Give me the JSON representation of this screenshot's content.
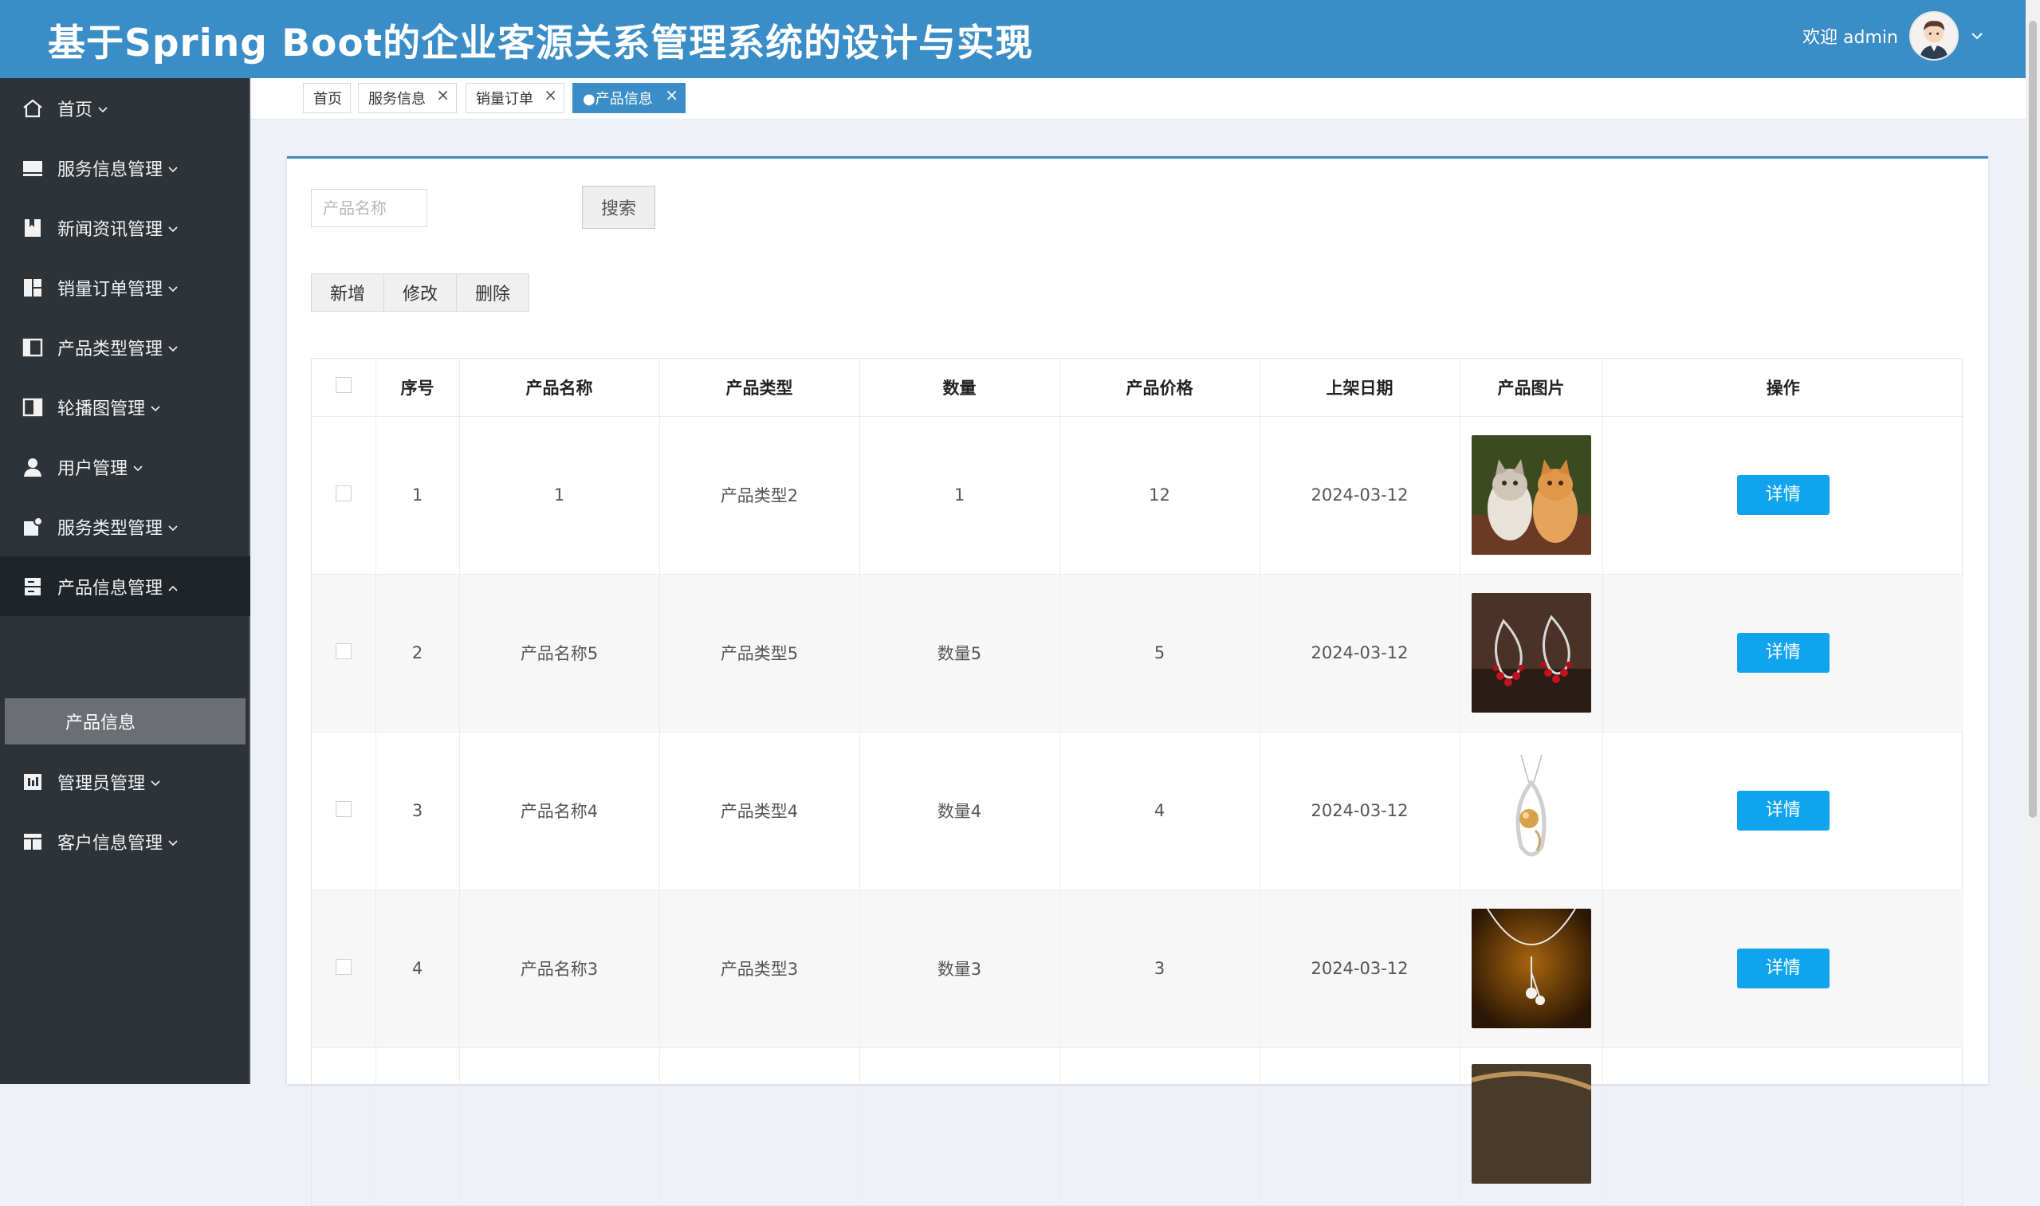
{
  "header": {
    "title": "基于Spring Boot的企业客源关系管理系统的设计与实现",
    "welcome": "欢迎 admin",
    "brand_color": "#3a8dc7"
  },
  "sidebar": {
    "items": [
      {
        "label": "首页",
        "icon": "home-icon"
      },
      {
        "label": "服务信息管理",
        "icon": "monitor-icon"
      },
      {
        "label": "新闻资讯管理",
        "icon": "bookmark-icon"
      },
      {
        "label": "销量订单管理",
        "icon": "dashboard-icon"
      },
      {
        "label": "产品类型管理",
        "icon": "columns-icon"
      },
      {
        "label": "轮播图管理",
        "icon": "slides-icon"
      },
      {
        "label": "用户管理",
        "icon": "user-icon"
      },
      {
        "label": "服务类型管理",
        "icon": "tag-icon"
      },
      {
        "label": "产品信息管理",
        "icon": "server-icon"
      },
      {
        "label": "管理员管理",
        "icon": "chart-icon"
      },
      {
        "label": "客户信息管理",
        "icon": "table-icon"
      }
    ],
    "sub_item": "产品信息"
  },
  "tabs": [
    {
      "label": "首页"
    },
    {
      "label": "服务信息"
    },
    {
      "label": "销量订单"
    },
    {
      "label": "●产品信息"
    }
  ],
  "search": {
    "placeholder": "产品名称",
    "button": "搜索"
  },
  "toolbar": {
    "add": "新增",
    "edit": "修改",
    "delete": "删除"
  },
  "table": {
    "headers": [
      "序号",
      "产品名称",
      "产品类型",
      "数量",
      "产品价格",
      "上架日期",
      "产品图片",
      "操作"
    ],
    "rows": [
      {
        "no": "1",
        "name": "1",
        "type": "产品类型2",
        "qty": "1",
        "price": "12",
        "date": "2024-03-12",
        "image": "kittens-photo",
        "action": "详情"
      },
      {
        "no": "2",
        "name": "产品名称5",
        "type": "产品类型5",
        "qty": "数量5",
        "price": "5",
        "date": "2024-03-12",
        "image": "earrings-photo",
        "action": "详情"
      },
      {
        "no": "3",
        "name": "产品名称4",
        "type": "产品类型4",
        "qty": "数量4",
        "price": "4",
        "date": "2024-03-12",
        "image": "pearl-pendant-photo",
        "action": "详情"
      },
      {
        "no": "4",
        "name": "产品名称3",
        "type": "产品类型3",
        "qty": "数量3",
        "price": "3",
        "date": "2024-03-12",
        "image": "pearl-necklace-photo",
        "action": "详情"
      }
    ]
  }
}
